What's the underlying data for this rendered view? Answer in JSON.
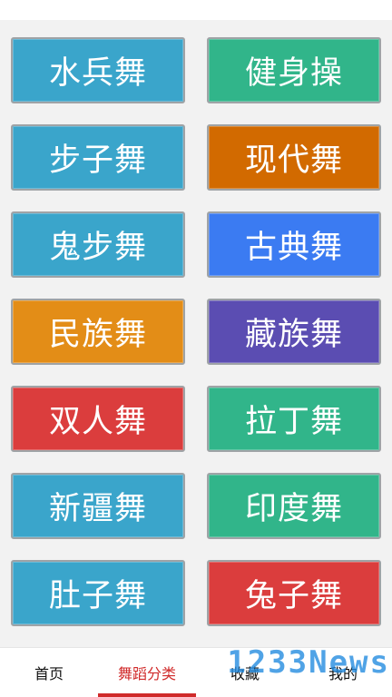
{
  "tiles": [
    {
      "label": "水兵舞",
      "color": "#3aa5cb"
    },
    {
      "label": "健身操",
      "color": "#31b58a"
    },
    {
      "label": "步子舞",
      "color": "#3aa5cb"
    },
    {
      "label": "现代舞",
      "color": "#d26a00"
    },
    {
      "label": "鬼步舞",
      "color": "#3aa5cb"
    },
    {
      "label": "古典舞",
      "color": "#3b7bf2"
    },
    {
      "label": "民族舞",
      "color": "#e38d17"
    },
    {
      "label": "藏族舞",
      "color": "#5b4db2"
    },
    {
      "label": "双人舞",
      "color": "#db3d3d"
    },
    {
      "label": "拉丁舞",
      "color": "#31b58a"
    },
    {
      "label": "新疆舞",
      "color": "#3aa5cb"
    },
    {
      "label": "印度舞",
      "color": "#31b58a"
    },
    {
      "label": "肚子舞",
      "color": "#3aa5cb"
    },
    {
      "label": "兔子舞",
      "color": "#db3d3d"
    }
  ],
  "tabbar": {
    "tabs": [
      {
        "label": "首页"
      },
      {
        "label": "舞蹈分类"
      },
      {
        "label": "收藏"
      },
      {
        "label": "我的"
      }
    ],
    "active_index": 1,
    "active_color": "#d02a2a"
  },
  "watermark": "1233News"
}
